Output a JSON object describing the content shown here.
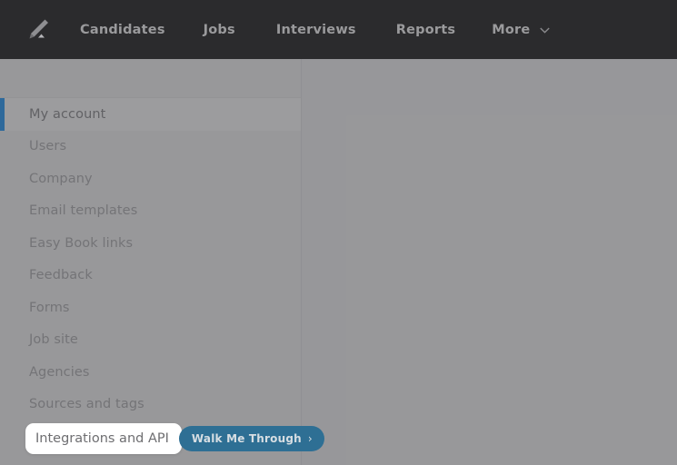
{
  "topnav": {
    "logo_icon": "pen-logo-icon",
    "items": [
      {
        "label": "Candidates",
        "key": "candidates"
      },
      {
        "label": "Jobs",
        "key": "jobs"
      },
      {
        "label": "Interviews",
        "key": "interviews"
      },
      {
        "label": "Reports",
        "key": "reports"
      },
      {
        "label": "More",
        "key": "more",
        "icon": "chevron-down-icon"
      }
    ]
  },
  "sidebar": {
    "items": [
      {
        "label": "My account",
        "active": true
      },
      {
        "label": "Users",
        "active": false
      },
      {
        "label": "Company",
        "active": false
      },
      {
        "label": "Email templates",
        "active": false
      },
      {
        "label": "Easy Book links",
        "active": false
      },
      {
        "label": "Feedback",
        "active": false
      },
      {
        "label": "Forms",
        "active": false
      },
      {
        "label": "Job site",
        "active": false
      },
      {
        "label": "Agencies",
        "active": false
      },
      {
        "label": "Sources and tags",
        "active": false
      },
      {
        "label": "Integrations and API",
        "active": false,
        "spotlighted": true
      }
    ]
  },
  "walkthrough": {
    "spotlight_label": "Integrations and API",
    "button_label": "Walk Me Through",
    "button_arrow": "›"
  },
  "colors": {
    "topbar_bg": "#2b2b2d",
    "topnav_text": "#9a9a9c",
    "page_bg": "#aaaaac",
    "sidepanel_bg": "#ababad",
    "sidebar_text": "#77777a",
    "active_accent": "#1368ae",
    "active_row_bg": "#b0b0b2",
    "spotlight_bg": "#ffffff",
    "walk_button_bg": "#2e6f94",
    "walk_button_text": "#d7dee3",
    "veil": "rgba(110,110,113,0.30)"
  }
}
